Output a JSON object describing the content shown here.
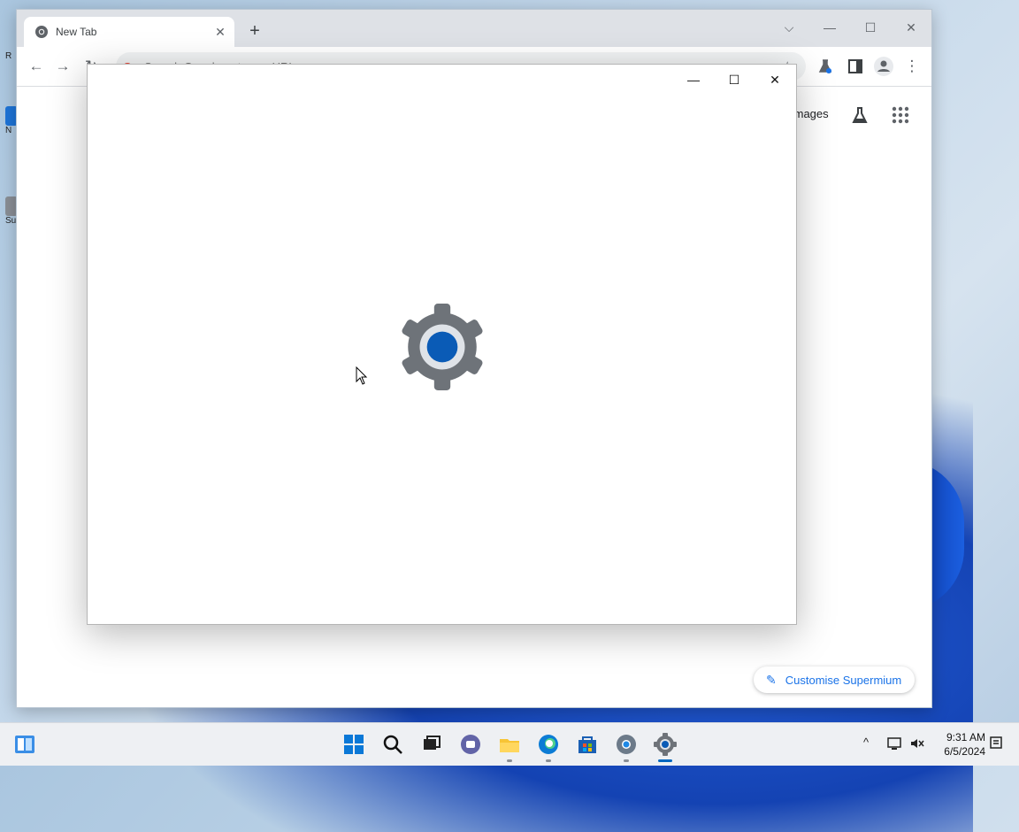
{
  "desktop": {
    "icons": [
      {
        "label": "R"
      },
      {
        "label": "N"
      },
      {
        "label": "Su"
      }
    ]
  },
  "browser": {
    "tab": {
      "title": "New Tab"
    },
    "new_tab_symbol": "+",
    "window_controls": {
      "dropdown": "⌵",
      "minimize": "—",
      "maximize": "☐",
      "close": "✕"
    },
    "toolbar": {
      "back": "←",
      "forward": "→",
      "reload": "↻"
    },
    "omnibox": {
      "placeholder": "Search Google or type a URL"
    },
    "ntp": {
      "images_link": "Images"
    },
    "customise_button": "Customise Supermium"
  },
  "settings_window": {
    "controls": {
      "minimize": "—",
      "maximize": "☐",
      "close": "✕"
    }
  },
  "taskbar": {
    "clock": {
      "time": "9:31 AM",
      "date": "6/5/2024"
    },
    "tray": {
      "chevron": "^"
    }
  },
  "colors": {
    "accent": "#1a73e8",
    "gear_gray": "#6e7379",
    "gear_blue": "#0a5bb6",
    "taskbar_active": "#0067c0"
  }
}
